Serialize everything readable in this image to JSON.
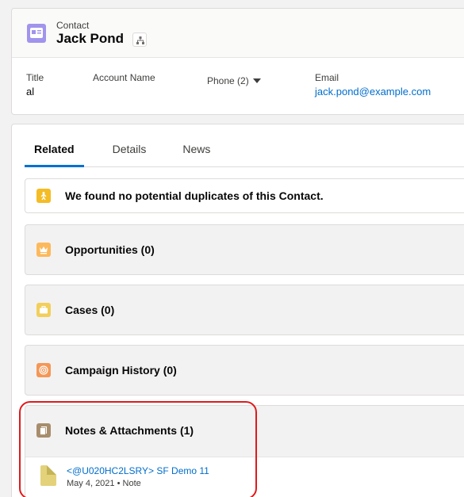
{
  "header": {
    "object_label": "Contact",
    "record_name": "Jack Pond",
    "fields": {
      "title_label": "Title",
      "title_value": "al",
      "account_label": "Account Name",
      "phone_label": "Phone (2)",
      "email_label": "Email",
      "email_value": "jack.pond@example.com"
    }
  },
  "tabs": [
    {
      "label": "Related",
      "active": true
    },
    {
      "label": "Details",
      "active": false
    },
    {
      "label": "News",
      "active": false
    }
  ],
  "panels": {
    "duplicates": "We found no potential duplicates of this Contact.",
    "opportunities": "Opportunities (0)",
    "cases": "Cases (0)",
    "campaign_history": "Campaign History (0)",
    "notes": "Notes & Attachments (1)"
  },
  "notes_item": {
    "title": "<@U020HC2LSRY> SF Demo 11",
    "meta": "May 4, 2021 • Note"
  },
  "colors": {
    "contact_icon": "#a094ed",
    "duplicates_icon": "#f4bc25",
    "opportunities_icon": "#fcb95b",
    "cases_icon": "#f2cf5b",
    "campaign_icon": "#f49756",
    "notes_icon": "#a78d6c",
    "link": "#006dcc",
    "highlight": "#e0191c"
  },
  "icons": {
    "contact": "contact-card-icon",
    "hierarchy": "hierarchy-icon",
    "duplicates": "duplicate-figure-icon",
    "opportunities": "crown-icon",
    "cases": "briefcase-icon",
    "campaign": "target-icon",
    "notes": "file-icon",
    "note_file": "note-icon"
  }
}
